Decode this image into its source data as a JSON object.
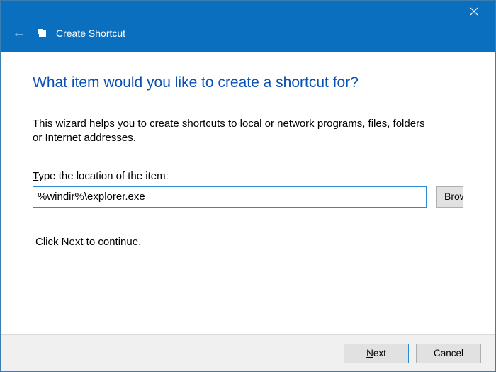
{
  "titlebar": {
    "title": "Create Shortcut"
  },
  "content": {
    "heading": "What item would you like to create a shortcut for?",
    "description_line1": "This wizard helps you to create shortcuts to local or network programs, files, folders",
    "description_line2": "or Internet addresses.",
    "location_label_prefix": "T",
    "location_label_rest": "ype the location of the item:",
    "location_value": "%windir%\\explorer.exe",
    "browse_label": "Browse…",
    "continue_text": "Click Next to continue."
  },
  "footer": {
    "next_prefix": "N",
    "next_rest": "ext",
    "cancel": "Cancel"
  }
}
